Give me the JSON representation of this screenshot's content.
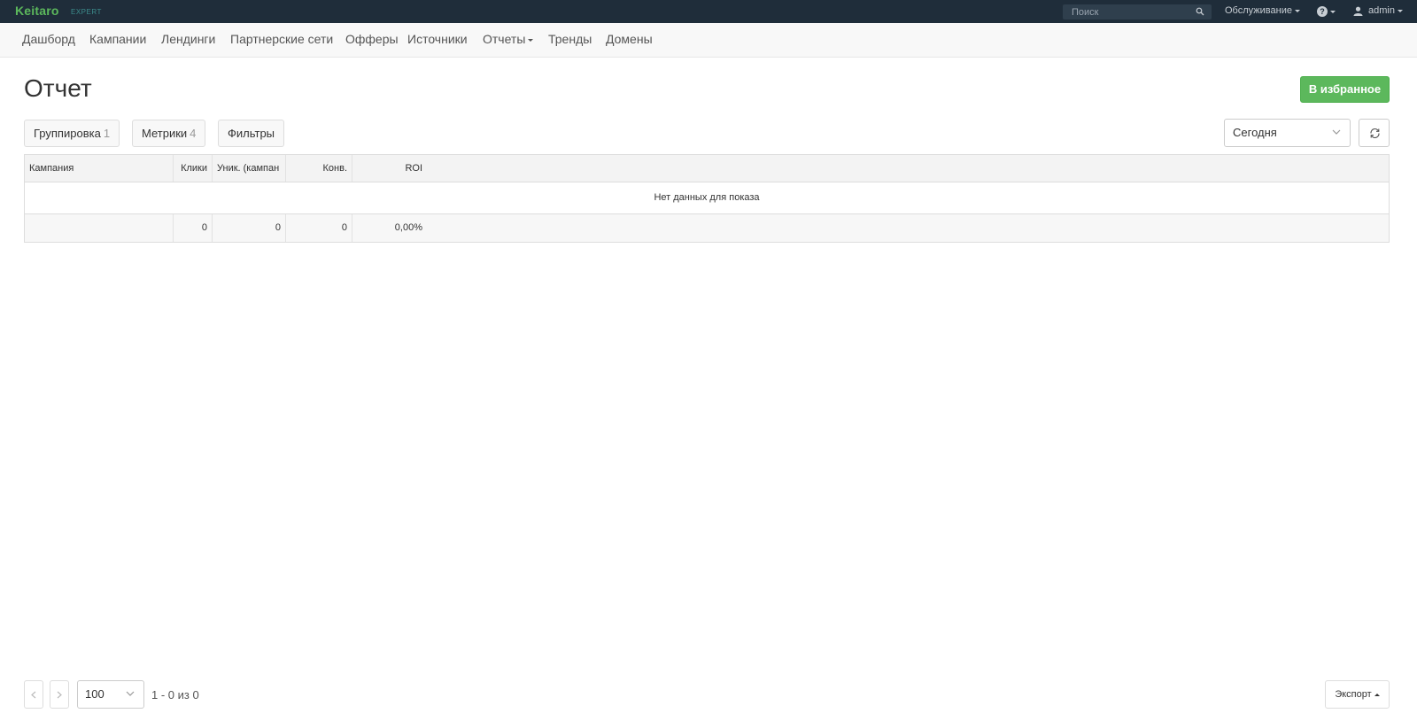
{
  "app": {
    "brand": "Keitaro",
    "edition": "EXPERT"
  },
  "topbar": {
    "search_placeholder": "Поиск",
    "service_label": "Обслуживание",
    "help_icon": "?",
    "user_label": "admin"
  },
  "nav": {
    "items": [
      {
        "label": "Дашборд"
      },
      {
        "label": "Кампании"
      },
      {
        "label": "Лендинги"
      },
      {
        "label": "Партнерские сети"
      },
      {
        "label": "Офферы"
      },
      {
        "label": "Источники"
      },
      {
        "label": "Отчеты"
      },
      {
        "label": "Тренды"
      },
      {
        "label": "Домены"
      }
    ]
  },
  "page": {
    "title": "Отчет",
    "favorite_button": "В избранное",
    "grouping_label": "Группировка",
    "grouping_count": "1",
    "metrics_label": "Метрики",
    "metrics_count": "4",
    "filters_label": "Фильтры",
    "period_value": "Сегодня"
  },
  "table": {
    "columns": [
      "Кампания",
      "Клики",
      "Уник. (кампан",
      "Конв.",
      "ROI"
    ],
    "empty_message": "Нет данных для показа",
    "totals": [
      "",
      "0",
      "0",
      "0",
      "0,00%"
    ]
  },
  "footer": {
    "page_size": "100",
    "page_info": "1 - 0 из 0",
    "export_label": "Экспорт"
  },
  "colors": {
    "topbar_bg": "#1f2d3a",
    "brand_green": "#5cb85c",
    "favorite_button": "#5cb85c"
  }
}
